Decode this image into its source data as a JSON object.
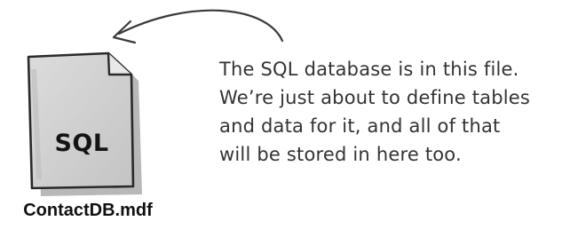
{
  "file": {
    "badge": "SQL",
    "name": "ContactDB.mdf"
  },
  "annotation": {
    "lines": [
      "The SQL database is in this file.",
      "We’re just about to define tables",
      "and data for it, and all of that",
      "will be stored in here too."
    ]
  },
  "colors": {
    "icon_fill": "#cfcfcf",
    "icon_shadow": "#8f8f8f",
    "ink": "#333333",
    "label": "#111111"
  },
  "icons": {
    "file": "document-file-icon",
    "arrow": "curved-arrow-icon"
  }
}
